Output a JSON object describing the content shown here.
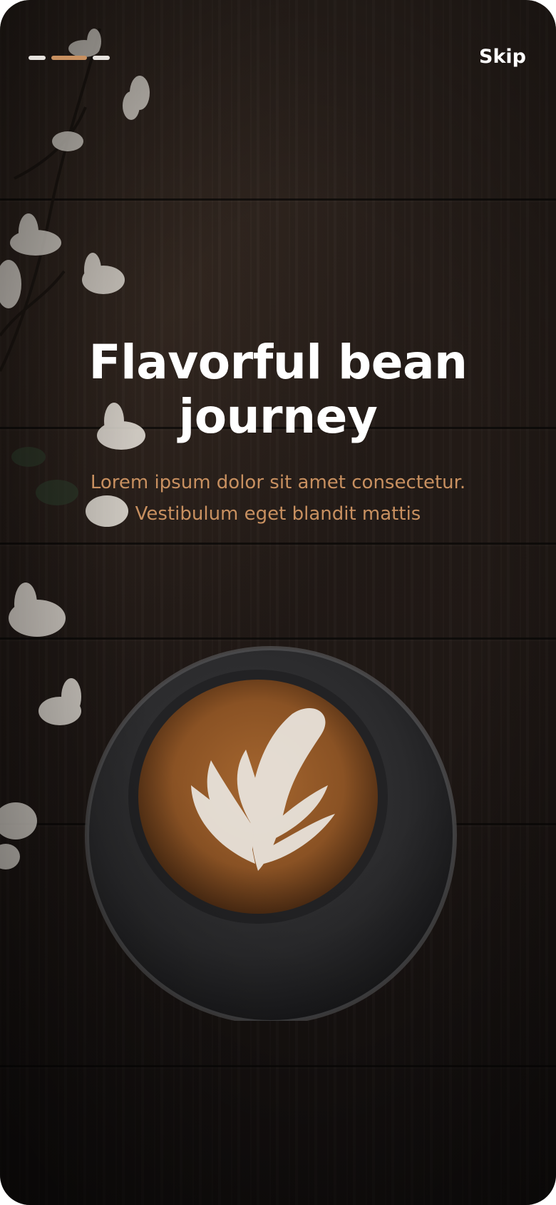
{
  "onboarding": {
    "progress": {
      "total_steps": 3,
      "current_step": 2
    },
    "skip_label": "Skip",
    "title_lines": [
      "Flavorful bean",
      "journey"
    ],
    "subtitle_lines": [
      "Lorem ipsum dolor sit amet consectetur.",
      "Vestibulum eget blandit mattis"
    ]
  },
  "colors": {
    "accent": "#c89060",
    "inactive_dash": "#e6e2de",
    "title": "#ffffff",
    "background": "#231b17"
  },
  "background_image": {
    "subject": "latte-art-coffee-cup-on-wooden-table-with-white-flowers"
  }
}
